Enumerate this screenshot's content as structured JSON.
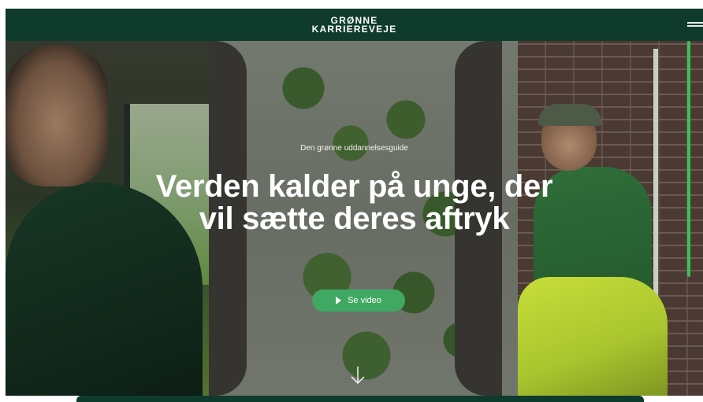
{
  "header": {
    "logo_line1": "GRØNNE",
    "logo_line2": "KARRIEREVEJE"
  },
  "hero": {
    "eyebrow": "Den grønne uddannelsesguide",
    "headline": "Verden kalder på unge, der vil sætte deres aftryk",
    "cta_label": "Se video"
  },
  "colors": {
    "brand_dark_green": "#0f3b2c",
    "cta_green": "#3fa862"
  },
  "icons": {
    "menu": "hamburger-menu-icon",
    "play": "play-icon",
    "scroll": "arrow-down-icon"
  }
}
